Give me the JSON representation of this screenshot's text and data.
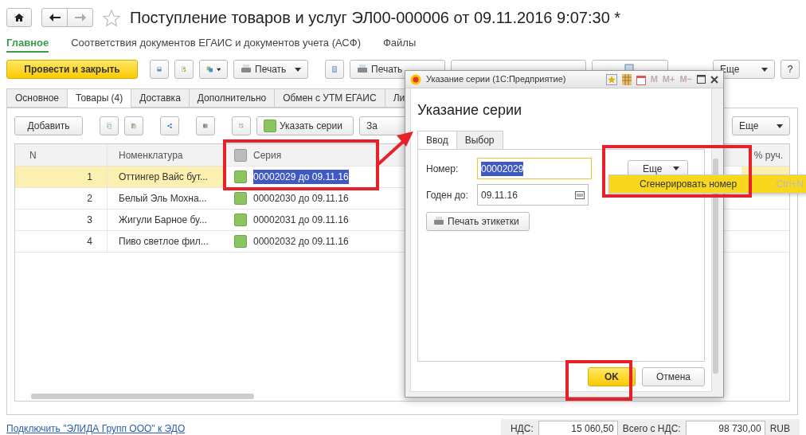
{
  "window": {
    "title": "Поступление товаров и услуг ЭЛ00-000006 от 09.11.2016 9:07:30 *"
  },
  "nav": [
    {
      "label": "Главное",
      "selected": true
    },
    {
      "label": "Соответствия документов ЕГАИС и документов учета (АСФ)",
      "selected": false
    },
    {
      "label": "Файлы",
      "selected": false
    }
  ],
  "toolbar": {
    "post_button": "Провести и закрыть",
    "print_button": "Печать",
    "print_asf_button": "Печать",
    "more_button": "Еще",
    "help_button": "?"
  },
  "tabs": [
    {
      "label": "Основное",
      "selected": false
    },
    {
      "label": "Товары (4)",
      "selected": true
    },
    {
      "label": "Доставка",
      "selected": false
    },
    {
      "label": "Дополнительно",
      "selected": false
    },
    {
      "label": "Обмен с УТМ ЕГАИС",
      "selected": false
    },
    {
      "label": "Ли",
      "selected": false
    }
  ],
  "table_toolbar": {
    "add_button": "Добавить",
    "series_button": "Указать серии",
    "fill_button": "За",
    "more_button": "Еще"
  },
  "table": {
    "columns": [
      "N",
      "Номенклатура",
      "Серия",
      "% руч."
    ],
    "rows": [
      {
        "n": "1",
        "item": "Оттингер Вайс бут...",
        "series": "00002029 до 09.11.16",
        "selected": true
      },
      {
        "n": "2",
        "item": "Белый Эль Мохна...",
        "series": "00002030 до 09.11.16",
        "selected": false
      },
      {
        "n": "3",
        "item": "Жигули Барное бу...",
        "series": "00002031 до 09.11.16",
        "selected": false
      },
      {
        "n": "4",
        "item": "Пиво светлое фил...",
        "series": "00002032 до 09.11.16",
        "selected": false
      }
    ]
  },
  "footer": {
    "link": "Подключить \"ЭЛИДА Групп ООО\" к ЭДО",
    "vat_label": "НДС:",
    "vat": "15 060,50",
    "total_label": "Всего с НДС:",
    "total": "98 730,00",
    "currency": "RUB"
  },
  "dialog": {
    "title": "Указание серии  (1С:Предприятие)",
    "tools": [
      {
        "label": "M",
        "disabled": true
      },
      {
        "label": "M+",
        "disabled": true
      },
      {
        "label": "M−",
        "disabled": true
      }
    ],
    "heading": "Указание серии",
    "tabs": [
      {
        "label": "Ввод",
        "selected": true
      },
      {
        "label": "Выбор",
        "selected": false
      }
    ],
    "number_label": "Номер:",
    "number": {
      "value": "00002029",
      "highlighted": true
    },
    "more_button": "Еще",
    "menu": [
      {
        "label": "Сгенерировать номер",
        "shortcut": "Ctrl+N",
        "selected": true
      }
    ],
    "expiry_label": "Годен до:",
    "expiry": "09.11.16",
    "print_labels_button": "Печать этикетки",
    "ok_button": "OK",
    "cancel_button": "Отмена"
  }
}
